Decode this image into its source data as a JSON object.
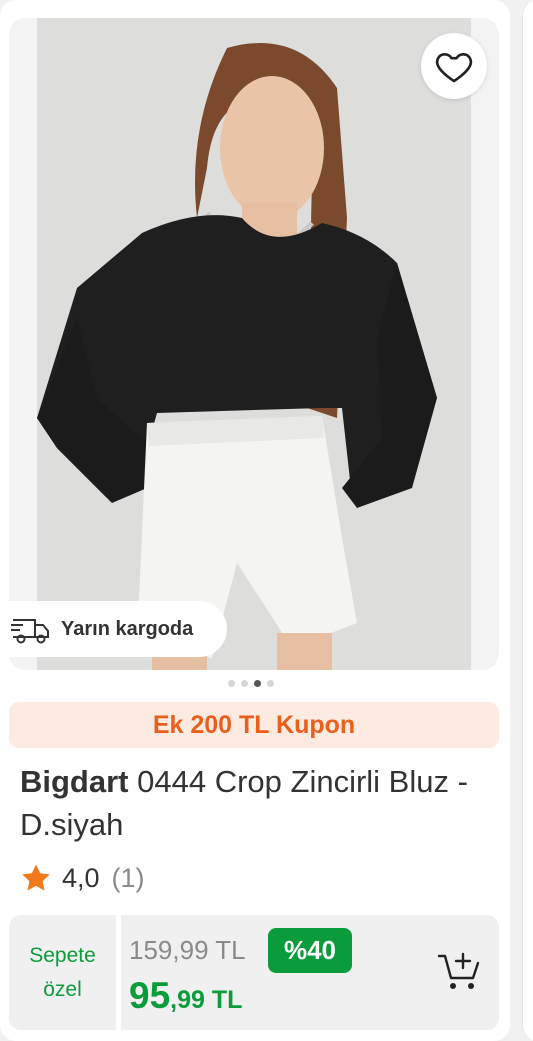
{
  "product": {
    "image_alt": "Bigdart 0444 Crop Zincirli Bluz - D.siyah",
    "shipping_badge": "Yarın kargoda",
    "coupon": "Ek 200 TL Kupon",
    "brand": "Bigdart",
    "name": "0444 Crop Zincirli Bluz - D.siyah",
    "rating": "4,0",
    "review_count": "(1)",
    "special_label_line1": "Sepete",
    "special_label_line2": "özel",
    "old_price": "159,99 TL",
    "discount": "%40",
    "new_price_int": "95",
    "new_price_dec": ",99 TL"
  },
  "carousel": {
    "dots": 4,
    "active_index": 2
  },
  "colors": {
    "accent_green": "#0a9c3a",
    "coupon_orange": "#e8601c",
    "coupon_bg": "#fdebe2",
    "star": "#f27a1a"
  },
  "icons": [
    "heart-icon",
    "truck-icon",
    "star-icon",
    "add-to-cart-icon"
  ]
}
